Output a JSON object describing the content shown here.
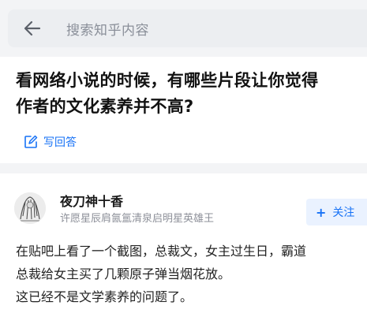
{
  "search": {
    "placeholder": "搜索知乎内容",
    "back_icon": "arrow-left-icon"
  },
  "question": {
    "title_line1": "看网络小说的时候，有哪些片段让你觉得",
    "title_line2": "作者的文化素养并不高?",
    "write_answer_label": "写回答",
    "write_answer_icon": "pencil-icon"
  },
  "answer": {
    "author_name": "夜刀神十香",
    "author_bio": "许愿星辰肩氤氲清泉启明星英雄王",
    "follow_label": "关注",
    "follow_icon": "plus-icon",
    "avatar_icon": "avatar-icon",
    "body_lines": [
      "在贴吧上看了一个截图，总裁文，女主过生日，霸道",
      "总裁给女主买了几颗原子弹当烟花放。",
      "这已经不是文学素养的问题了。"
    ]
  },
  "colors": {
    "accent": "#1772f6",
    "background": "#f3f4f6",
    "card": "#ffffff",
    "muted_text": "#8d9099"
  }
}
